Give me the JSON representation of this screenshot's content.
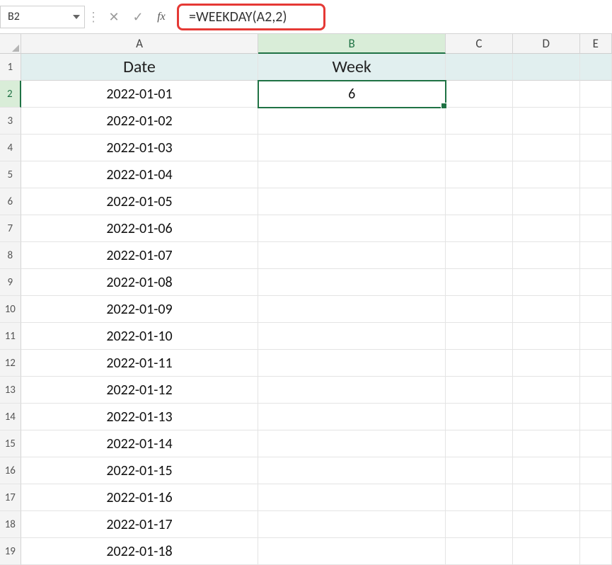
{
  "nameBox": {
    "value": "B2"
  },
  "formulaBar": {
    "cancelGlyph": "✕",
    "confirmGlyph": "✓",
    "fxLabel": "fx",
    "formula": "=WEEKDAY(A2,2)"
  },
  "columns": [
    {
      "key": "A",
      "label": "A",
      "active": false
    },
    {
      "key": "B",
      "label": "B",
      "active": true
    },
    {
      "key": "C",
      "label": "C",
      "active": false
    },
    {
      "key": "D",
      "label": "D",
      "active": false
    },
    {
      "key": "E",
      "label": "E",
      "active": false
    }
  ],
  "header": {
    "A": "Date",
    "B": "Week"
  },
  "selectedCell": {
    "row": 2,
    "col": "B"
  },
  "rows": [
    {
      "n": 1,
      "A": "Date",
      "B": "Week",
      "isHeader": true
    },
    {
      "n": 2,
      "A": "2022-01-01",
      "B": "6"
    },
    {
      "n": 3,
      "A": "2022-01-02",
      "B": ""
    },
    {
      "n": 4,
      "A": "2022-01-03",
      "B": ""
    },
    {
      "n": 5,
      "A": "2022-01-04",
      "B": ""
    },
    {
      "n": 6,
      "A": "2022-01-05",
      "B": ""
    },
    {
      "n": 7,
      "A": "2022-01-06",
      "B": ""
    },
    {
      "n": 8,
      "A": "2022-01-07",
      "B": ""
    },
    {
      "n": 9,
      "A": "2022-01-08",
      "B": ""
    },
    {
      "n": 10,
      "A": "2022-01-09",
      "B": ""
    },
    {
      "n": 11,
      "A": "2022-01-10",
      "B": ""
    },
    {
      "n": 12,
      "A": "2022-01-11",
      "B": ""
    },
    {
      "n": 13,
      "A": "2022-01-12",
      "B": ""
    },
    {
      "n": 14,
      "A": "2022-01-13",
      "B": ""
    },
    {
      "n": 15,
      "A": "2022-01-14",
      "B": ""
    },
    {
      "n": 16,
      "A": "2022-01-15",
      "B": ""
    },
    {
      "n": 17,
      "A": "2022-01-16",
      "B": ""
    },
    {
      "n": 18,
      "A": "2022-01-17",
      "B": ""
    },
    {
      "n": 19,
      "A": "2022-01-18",
      "B": ""
    }
  ]
}
